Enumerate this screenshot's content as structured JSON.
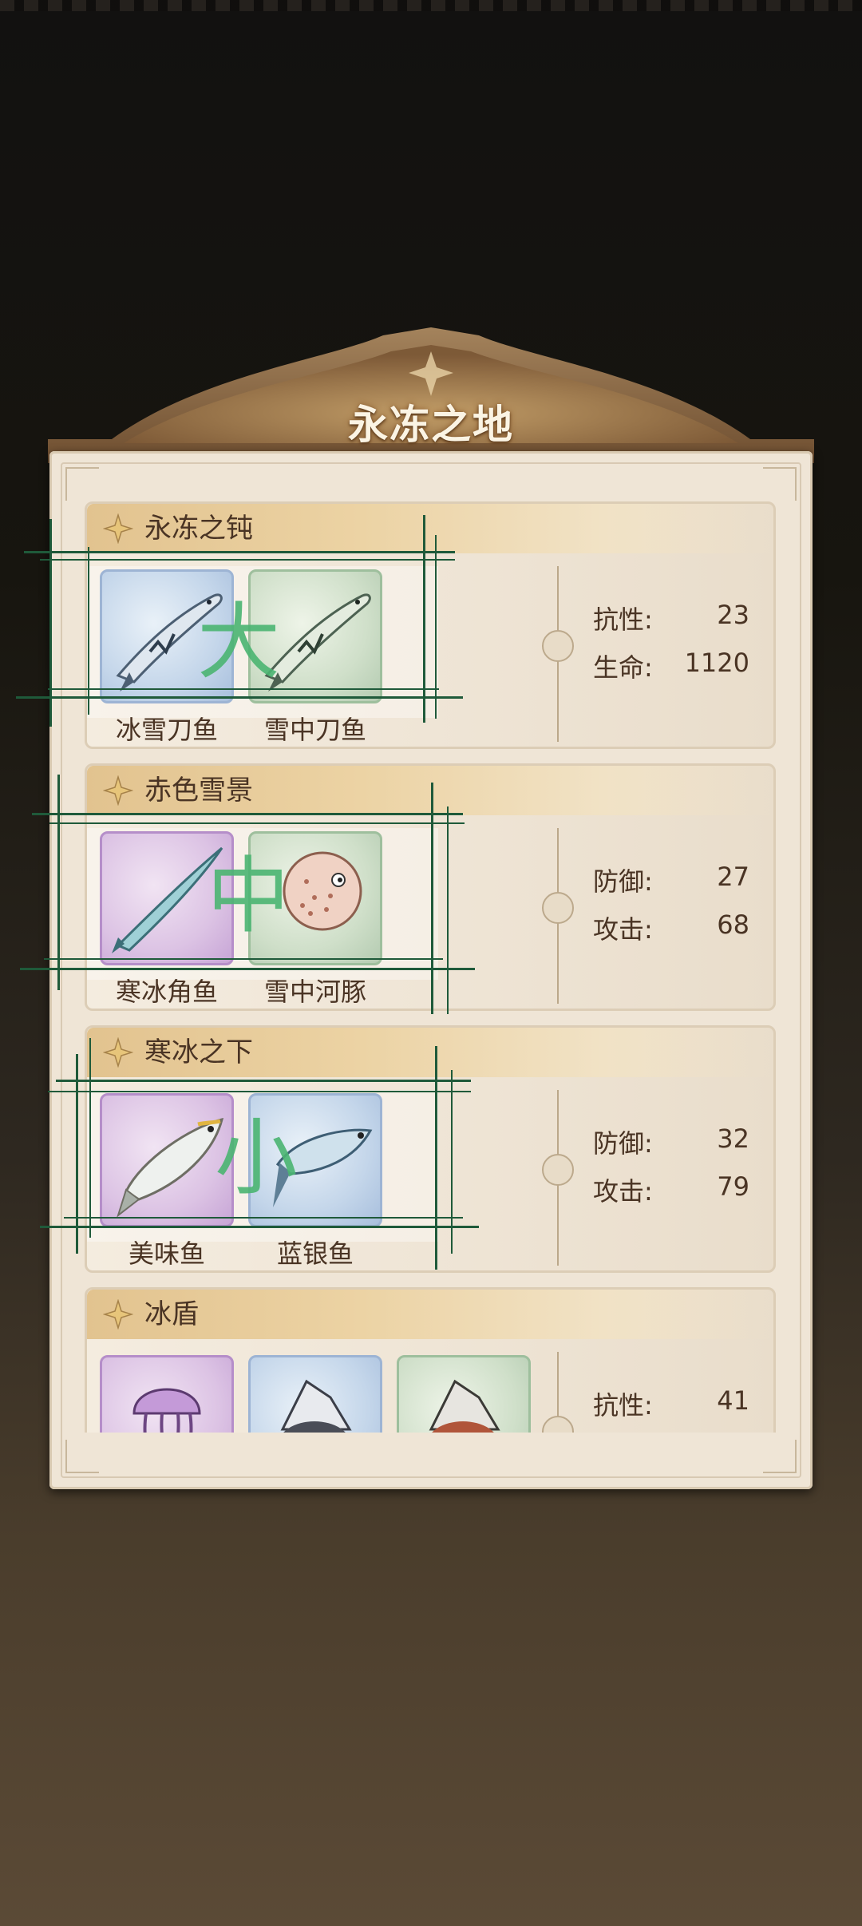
{
  "panel": {
    "title": "永冻之地"
  },
  "cards": [
    {
      "title": "永冻之钝",
      "fish": [
        {
          "name": "冰雪刀鱼",
          "tile_color": "blue",
          "icon": "swordfish-icon"
        },
        {
          "name": "雪中刀鱼",
          "tile_color": "green",
          "icon": "swordfish-icon"
        }
      ],
      "stats": [
        {
          "label": "抗性:",
          "value": "23"
        },
        {
          "label": "生命:",
          "value": "1120"
        }
      ],
      "overlay": "大"
    },
    {
      "title": "赤色雪景",
      "fish": [
        {
          "name": "寒冰角鱼",
          "tile_color": "purple",
          "icon": "needlefish-icon"
        },
        {
          "name": "雪中河豚",
          "tile_color": "green",
          "icon": "pufferfish-icon"
        }
      ],
      "stats": [
        {
          "label": "防御:",
          "value": "27"
        },
        {
          "label": "攻击:",
          "value": "68"
        }
      ],
      "overlay": "中"
    },
    {
      "title": "寒冰之下",
      "fish": [
        {
          "name": "美味鱼",
          "tile_color": "purple",
          "icon": "fish-icon"
        },
        {
          "name": "蓝银鱼",
          "tile_color": "blue",
          "icon": "fish-icon"
        }
      ],
      "stats": [
        {
          "label": "防御:",
          "value": "32"
        },
        {
          "label": "攻击:",
          "value": "79"
        }
      ],
      "overlay": "小"
    },
    {
      "title": "冰盾",
      "fish": [
        {
          "name": "",
          "tile_color": "purple",
          "icon": "jellyfish-icon"
        },
        {
          "name": "",
          "tile_color": "blue",
          "icon": "hermit-crab-icon"
        },
        {
          "name": "",
          "tile_color": "green",
          "icon": "hermit-crab-icon"
        }
      ],
      "stats": [
        {
          "label": "抗性:",
          "value": "41"
        }
      ]
    }
  ],
  "colors": {
    "accent_text": "#4a3424",
    "overlay_green": "#4bb572",
    "guide_line": "#1f5a3a"
  }
}
